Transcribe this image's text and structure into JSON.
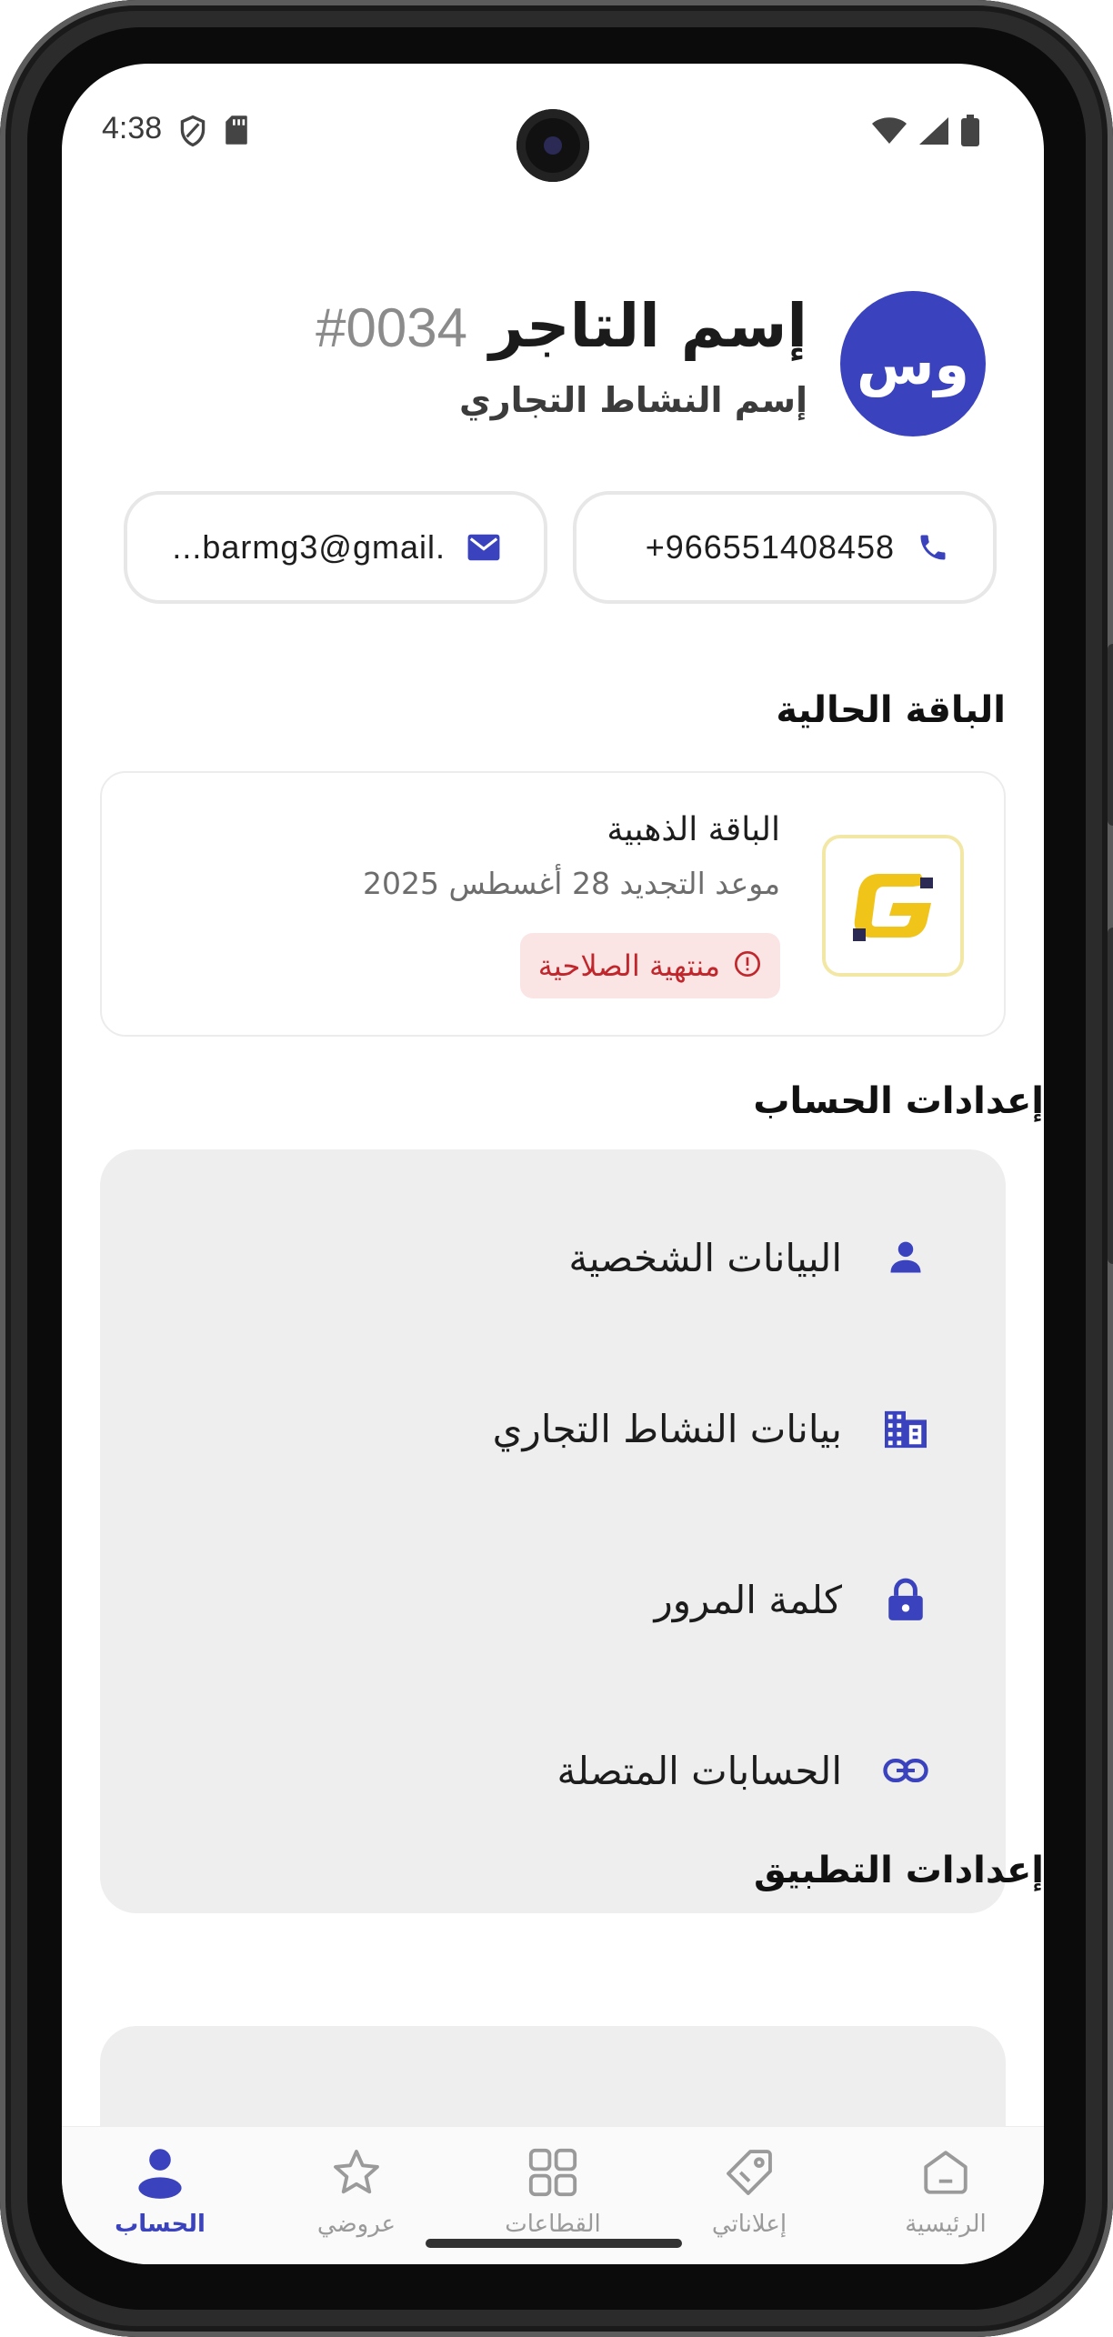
{
  "status_bar": {
    "time": "4:38"
  },
  "profile": {
    "avatar_initials": "وس",
    "merchant_name": "إسم التاجر",
    "merchant_id": "#0034",
    "business_name": "إسم النشاط التجاري"
  },
  "contacts": {
    "phone": "+966551408458",
    "email": "...barmg3@gmail."
  },
  "current_plan": {
    "heading": "الباقة الحالية",
    "plan_name": "الباقة الذهبية",
    "renewal_text": "موعد التجديد 28 أغسطس 2025",
    "status": "منتهية الصلاحية"
  },
  "account_settings": {
    "heading": "إعدادات الحساب",
    "items": [
      {
        "label": "البيانات الشخصية",
        "icon": "person-icon"
      },
      {
        "label": "بيانات النشاط التجاري",
        "icon": "building-icon"
      },
      {
        "label": "كلمة المرور",
        "icon": "lock-icon"
      },
      {
        "label": "الحسابات المتصلة",
        "icon": "link-icon"
      }
    ]
  },
  "app_settings": {
    "heading": "إعدادات التطبيق"
  },
  "bottom_nav": {
    "items": [
      {
        "label": "الحساب",
        "icon": "person-icon",
        "active": true
      },
      {
        "label": "عروضي",
        "icon": "star-icon",
        "active": false
      },
      {
        "label": "القطاعات",
        "icon": "grid-icon",
        "active": false
      },
      {
        "label": "إعلاناتي",
        "icon": "tag-icon",
        "active": false
      },
      {
        "label": "الرئيسية",
        "icon": "home-icon",
        "active": false
      }
    ]
  },
  "colors": {
    "accent": "#3a43bd",
    "badge_bg": "#fbe4e4",
    "badge_text": "#c0272d",
    "logo_yellow": "#f0c419"
  }
}
